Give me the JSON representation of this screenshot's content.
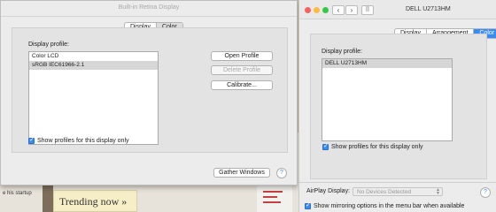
{
  "background": {
    "side_text": "e his startup",
    "trending": "Trending now »"
  },
  "win1": {
    "title": "Built-in Retina Display",
    "tabs": [
      "Display",
      "Color"
    ],
    "profile_label": "Display profile:",
    "profiles": [
      "Color LCD",
      "sRGB IEC61966-2.1"
    ],
    "buttons": {
      "open": "Open Profile",
      "delete": "Delete Profile",
      "calibrate": "Calibrate..."
    },
    "show_profiles": "Show profiles for this display only",
    "gather": "Gather Windows",
    "help": "?"
  },
  "win2": {
    "title": "DELL U2713HM",
    "tabs": [
      "Display",
      "Arrangement",
      "Color"
    ],
    "profile_label": "Display profile:",
    "profiles": [
      "DELL U2713HM"
    ],
    "show_profiles": "Show profiles for this display only",
    "airplay_label": "AirPlay Display:",
    "airplay_value": "No Devices Detected",
    "mirroring": "Show mirroring options in the menu bar when available",
    "help": "?"
  },
  "colors": {
    "accent": "#3a8cf5",
    "close": "#fc605c",
    "minimize": "#fdbc40",
    "zoom": "#34c84a"
  }
}
